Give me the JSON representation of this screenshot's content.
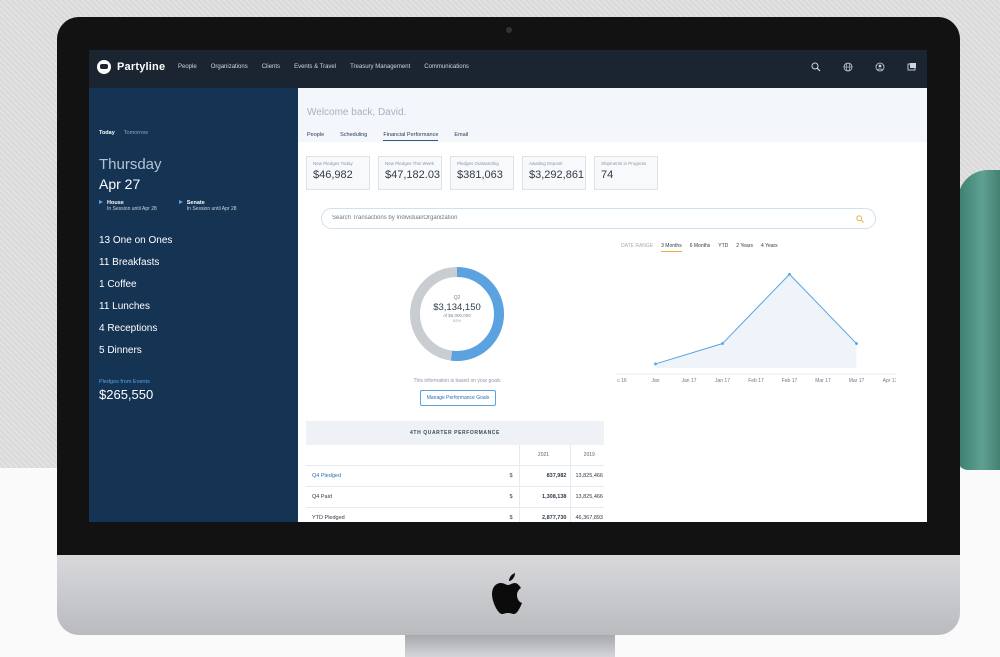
{
  "brand": {
    "name": "Partyline"
  },
  "nav": {
    "items": [
      "People",
      "Organizations",
      "Clients",
      "Events & Travel",
      "Treasury Management",
      "Communications"
    ],
    "icons": [
      "search-icon",
      "globe-icon",
      "user-icon",
      "window-icon"
    ]
  },
  "sidebar": {
    "tabs": [
      "Today",
      "Tomorrow"
    ],
    "weekday": "Thursday",
    "date": "Apr 27",
    "chambers": [
      {
        "name": "House",
        "status": "In Session until Apr 28"
      },
      {
        "name": "Senate",
        "status": "In Session until Apr 28"
      }
    ],
    "events": [
      "13 One on Ones",
      "11 Breakfasts",
      "1 Coffee",
      "11 Lunches",
      "4 Receptions",
      "5 Dinners"
    ],
    "pledges_label": "Pledges from Events",
    "pledges_value": "$265,550"
  },
  "main": {
    "welcome": "Welcome back, David.",
    "tabs": [
      "People",
      "Scheduling",
      "Financial Performance",
      "Email"
    ],
    "active_tab": "Financial Performance",
    "cards": [
      {
        "label": "New Pledges Today",
        "value": "$46,982"
      },
      {
        "label": "New Pledges This Week",
        "value": "$47,182.03"
      },
      {
        "label": "Pledges Outstanding",
        "value": "$381,063"
      },
      {
        "label": "Awaiting Deposit",
        "value": "$3,292,861"
      },
      {
        "label": "Shipments in Progress",
        "value": "74"
      }
    ],
    "search": {
      "placeholder": "Search Transactions by Individual/Organization"
    },
    "donut": {
      "period": "Q2",
      "value": "$3,134,150",
      "goal": "of $6,000,000",
      "percent": "52%",
      "fraction": 0.52,
      "note": "This information is based on your goals",
      "button": "Manage Performance Goals"
    },
    "performance": {
      "title": "4TH QUARTER PERFORMANCE",
      "years": [
        "2021",
        "2019"
      ],
      "rows": [
        {
          "label": "Q4 Pledged",
          "currency": "$",
          "v2021": "837,982",
          "v2019": "13,825,466"
        },
        {
          "label": "Q4 Paid",
          "currency": "$",
          "v2021": "1,308,138",
          "v2019": "13,825,466"
        },
        {
          "label": "YTD Pledged",
          "currency": "$",
          "v2021": "2,877,730",
          "v2019": "46,367,893"
        }
      ]
    },
    "ranges": {
      "lead": "DATE RANGE",
      "options": [
        "3 Months",
        "6 Months",
        "YTD",
        "2 Years",
        "4 Years"
      ],
      "active": "3 Months"
    }
  },
  "chart_data": {
    "type": "area",
    "x": [
      "c 16",
      "Jan",
      "Jan 17",
      "Jan 17",
      "Feb 17",
      "Feb 17",
      "Mar 17",
      "Mar 17",
      "Apr 17"
    ],
    "series": [
      {
        "values": [
          null,
          10,
          null,
          60,
          null,
          230,
          null,
          60,
          null
        ]
      }
    ],
    "ylim": [
      0,
      260
    ],
    "color": "#5aa3e0",
    "fill": "#eef4fa"
  },
  "colors": {
    "nav": "#1b2431",
    "sidebar": "#153352",
    "accent": "#5aa3e0",
    "donut_rest": "#c9ccd1",
    "active_range": "#e3b23c"
  }
}
